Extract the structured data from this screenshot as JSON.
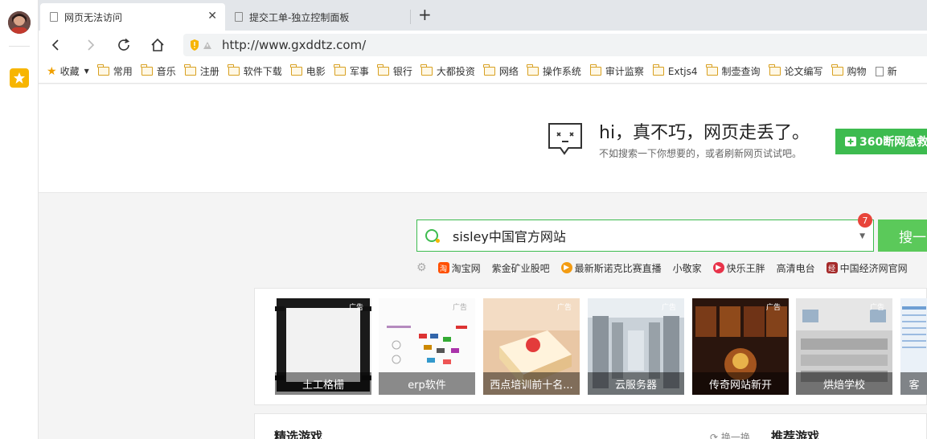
{
  "tabs": [
    {
      "title": "网页无法访问",
      "active": true
    },
    {
      "title": "提交工单-独立控制面板",
      "active": false
    }
  ],
  "address": {
    "url": "http://www.gxddtz.com/"
  },
  "bookmarks": {
    "favorites_label": "收藏",
    "items": [
      "常用",
      "音乐",
      "注册",
      "软件下载",
      "电影",
      "军事",
      "银行",
      "大都投资",
      "网络",
      "操作系统",
      "审计监察",
      "Extjs4",
      "制壶查询",
      "论文编写",
      "购物",
      "新"
    ]
  },
  "error": {
    "title": "hi，真不巧，网页走丢了。",
    "subtitle": "不如搜索一下你想要的，或者刷新网页试试吧。",
    "rescue_label": "360断网急救"
  },
  "search": {
    "query": "sisley中国官方网站",
    "badge": "7",
    "button_label": "搜一下"
  },
  "hot_links": [
    {
      "label": "淘宝网",
      "icon": "taobao-icon",
      "color": "#ff5000",
      "glyph": "淘"
    },
    {
      "label": "紫金矿业股吧",
      "icon": "",
      "color": "",
      "glyph": ""
    },
    {
      "label": "最新斯诺克比赛直播",
      "icon": "video-icon",
      "color": "#f39c12",
      "glyph": "▶"
    },
    {
      "label": "小敬家",
      "icon": "",
      "color": "",
      "glyph": ""
    },
    {
      "label": "快乐王胖",
      "icon": "play-icon",
      "color": "#e8334a",
      "glyph": "▶"
    },
    {
      "label": "高清电台",
      "icon": "",
      "color": "",
      "glyph": ""
    },
    {
      "label": "中国经济网官网",
      "icon": "news-icon",
      "color": "#a52a2a",
      "glyph": "经"
    }
  ],
  "ads": {
    "tag": "广告",
    "items": [
      {
        "caption": "土工格栅"
      },
      {
        "caption": "erp软件"
      },
      {
        "caption": "西点培训前十名..."
      },
      {
        "caption": "云服务器"
      },
      {
        "caption": "传奇网站新开"
      },
      {
        "caption": "烘焙学校"
      },
      {
        "caption": "客"
      }
    ]
  },
  "games": {
    "title": "精选游戏",
    "refresh_label": "换一换",
    "title2": "推荐游戏"
  }
}
